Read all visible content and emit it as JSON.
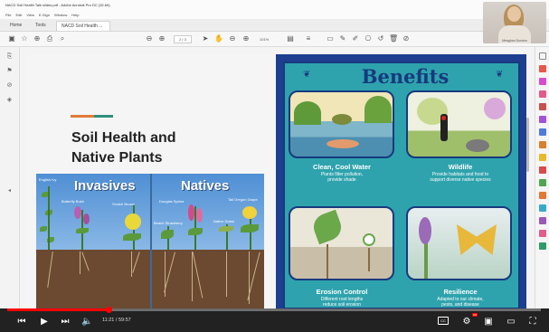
{
  "window": {
    "title": "NACD Soil Health Talk slides.pdf - Adobe Acrobat Pro DC (32-bit)"
  },
  "menu": [
    "File",
    "Edit",
    "View",
    "E-Sign",
    "Window",
    "Help"
  ],
  "tabs": [
    {
      "label": "Home"
    },
    {
      "label": "Tools"
    },
    {
      "label": "NACD Soil Health ..."
    }
  ],
  "toolbar": {
    "page": "2 / 3",
    "zoom": "101%"
  },
  "webcam": {
    "caption": "Meaghan Dundon"
  },
  "slide_left": {
    "title_line1": "Soil Health and",
    "title_line2": "Native Plants",
    "invasives_title": "Invasives",
    "natives_title": "Natives",
    "labels": {
      "english_ivy": "English Ivy",
      "butterfly_bush": "Butterfly Bush",
      "scotch_broom": "Scotch Broom",
      "douglas_spirea": "Douglas Spirea",
      "tall_oregon_grape": "Tall Oregon Grape",
      "beach_strawberry": "Beach Strawberry",
      "native_fern": "Native Grass"
    }
  },
  "slide_right": {
    "title": "Benefits",
    "panels": [
      {
        "title": "Clean, Cool Water",
        "desc_line1": "Plants filter pollution,",
        "desc_line2": "provide shade"
      },
      {
        "title": "Wildlife",
        "desc_line1": "Provide habitats and food to",
        "desc_line2": "support diverse native species"
      },
      {
        "title": "Erosion Control",
        "desc_line1": "Different root lengths",
        "desc_line2": "reduce soil erosion"
      },
      {
        "title": "Resilience",
        "desc_line1": "Adapted to our climate,",
        "desc_line2": "pests, and disease"
      }
    ]
  },
  "player": {
    "time": "11:21 / 59:57",
    "progress_fraction": 0.189,
    "cc_label": "CC",
    "hd_label": "HD"
  },
  "colors": {
    "accent_orange": "#e07b39",
    "accent_teal": "#2f8f7e",
    "benefits_bg": "#2fa3ad",
    "navy": "#173a7e",
    "progress_red": "#ff0000"
  }
}
